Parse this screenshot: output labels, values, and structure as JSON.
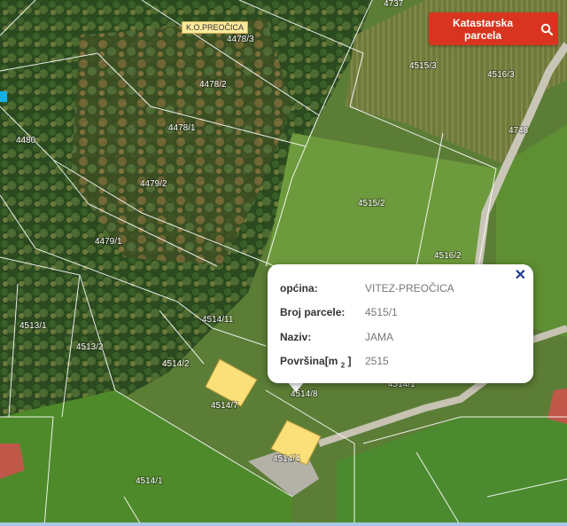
{
  "map": {
    "cadastral_area_label": "K.O.PREOČICA",
    "parcels": [
      {
        "id": "p4737",
        "label": "4737"
      },
      {
        "id": "p4478_3",
        "label": "4478/3"
      },
      {
        "id": "p4478_2",
        "label": "4478/2"
      },
      {
        "id": "p4478_1",
        "label": "4478/1"
      },
      {
        "id": "p4480",
        "label": "4480"
      },
      {
        "id": "p4479_2",
        "label": "4479/2"
      },
      {
        "id": "p4479_1",
        "label": "4479/1"
      },
      {
        "id": "p4515_3",
        "label": "4515/3"
      },
      {
        "id": "p4516_3",
        "label": "4516/3"
      },
      {
        "id": "p4748",
        "label": "4748"
      },
      {
        "id": "p4515_2",
        "label": "4515/2"
      },
      {
        "id": "p4516_2",
        "label": "4516/2"
      },
      {
        "id": "p4513_1",
        "label": "4513/1"
      },
      {
        "id": "p4513_2",
        "label": "4513/2"
      },
      {
        "id": "p4514_11",
        "label": "4514/11"
      },
      {
        "id": "p4514_2",
        "label": "4514/2"
      },
      {
        "id": "p4514_7",
        "label": "4514/7"
      },
      {
        "id": "p4514_8",
        "label": "4514/8"
      },
      {
        "id": "p4514_4",
        "label": "4514/4"
      },
      {
        "id": "p4514_1",
        "label": "4514/1"
      },
      {
        "id": "p4514_x",
        "label": "4514/1"
      }
    ]
  },
  "search_button": {
    "label": "Katastarska parcela",
    "icon": "search-icon"
  },
  "popup": {
    "rows": [
      {
        "key": "općina:",
        "value": "VITEZ-PREOČICA"
      },
      {
        "key": "Broj parcele:",
        "value": "4515/1"
      },
      {
        "key": "Naziv:",
        "value": "JAMA"
      },
      {
        "key_pre": "Površina[m",
        "key_sub": "2",
        "key_post": "]",
        "value": "2515"
      }
    ],
    "close_icon": "close-icon"
  },
  "colors": {
    "button": "#d8341f",
    "building": "#fbe07a",
    "close": "#1d3b8f"
  }
}
